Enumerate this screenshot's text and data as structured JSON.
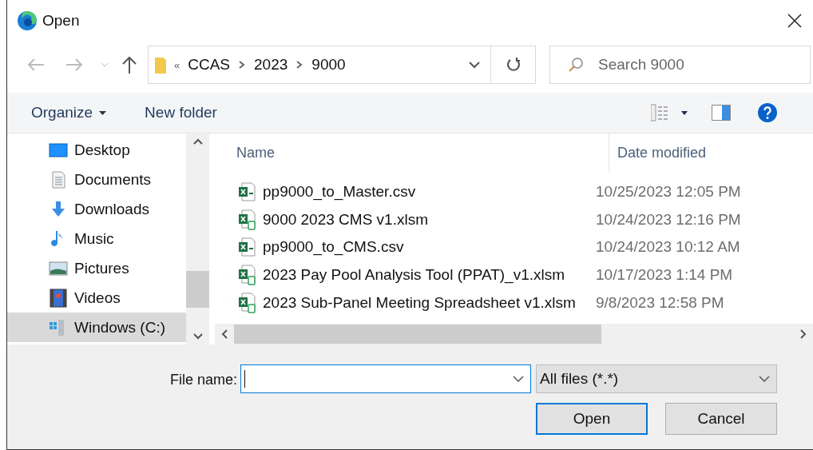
{
  "window": {
    "title": "Open"
  },
  "address": {
    "crumbs": [
      "«",
      "CCAS",
      "2023",
      "9000"
    ]
  },
  "search": {
    "placeholder": "Search 9000"
  },
  "toolbar": {
    "organize": "Organize",
    "new_folder": "New folder"
  },
  "nav_items": [
    {
      "label": "Desktop",
      "kind": "desktop",
      "selected": false
    },
    {
      "label": "Documents",
      "kind": "documents",
      "selected": false
    },
    {
      "label": "Downloads",
      "kind": "downloads",
      "selected": false
    },
    {
      "label": "Music",
      "kind": "music",
      "selected": false
    },
    {
      "label": "Pictures",
      "kind": "pictures",
      "selected": false
    },
    {
      "label": "Videos",
      "kind": "videos",
      "selected": false
    },
    {
      "label": "Windows (C:)",
      "kind": "drive",
      "selected": true
    }
  ],
  "table": {
    "columns": [
      "Name",
      "Date modified"
    ],
    "rows": [
      {
        "name": "pp9000_to_Master.csv",
        "kind": "csv",
        "date": "10/25/2023 12:05 PM"
      },
      {
        "name": "9000 2023 CMS v1.xlsm",
        "kind": "xlsm",
        "date": "10/24/2023 12:16 PM"
      },
      {
        "name": "pp9000_to_CMS.csv",
        "kind": "csv",
        "date": "10/24/2023 10:12 AM"
      },
      {
        "name": "2023 Pay Pool Analysis Tool (PPAT)_v1.xlsm",
        "kind": "xlsm",
        "date": "10/17/2023 1:14 PM"
      },
      {
        "name": "2023 Sub-Panel Meeting Spreadsheet v1.xlsm",
        "kind": "xlsm",
        "date": "9/8/2023 12:58 PM"
      }
    ]
  },
  "file_name": {
    "label": "File name:"
  },
  "file_type": {
    "value": "All files (*.*)"
  },
  "buttons": [
    {
      "label": "Open",
      "default": true
    },
    {
      "label": "Cancel",
      "default": false
    }
  ]
}
